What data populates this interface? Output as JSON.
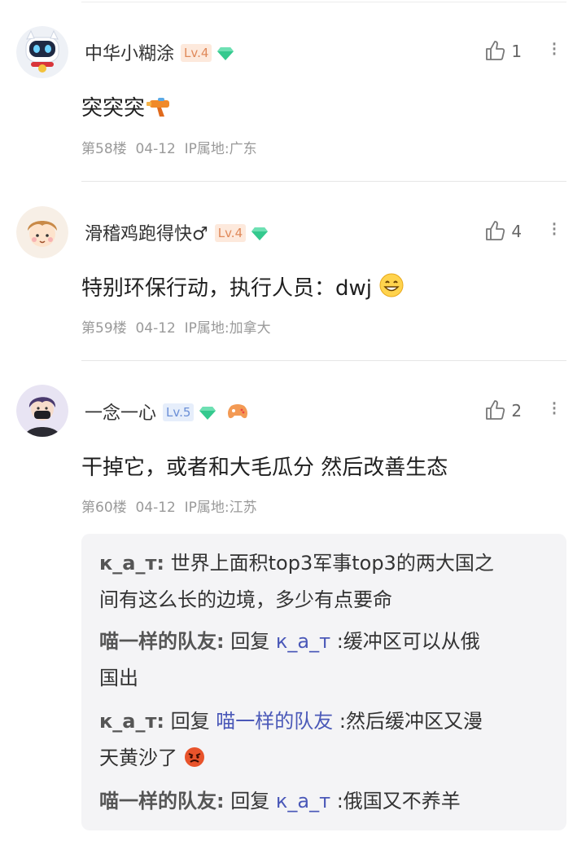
{
  "comments": [
    {
      "username": "中华小糊涂",
      "level": "Lv.4",
      "likes": "1",
      "text": "突突突",
      "emoji": "water-gun",
      "floor": "第58楼",
      "date": "04-12",
      "ip": "IP属地:广东"
    },
    {
      "username": "滑稽鸡跑得快♂",
      "level": "Lv.4",
      "likes": "4",
      "text": "特别环保行动，执行人员：dwj",
      "emoji": "grin-face",
      "floor": "第59楼",
      "date": "04-12",
      "ip": "IP属地:加拿大"
    },
    {
      "username": "一念一心",
      "level": "Lv.5",
      "likes": "2",
      "text": "干掉它，或者和大毛瓜分 然后改善生态",
      "floor": "第60楼",
      "date": "04-12",
      "ip": "IP属地:江苏"
    }
  ],
  "replies": [
    {
      "author": "к_а_т:",
      "text_line1": " 世界上面积top3军事top3的两大国之",
      "text_line2": "间有这么长的边境，多少有点要命"
    },
    {
      "author": "喵一样的队友:",
      "reply_word": " 回复 ",
      "target": "к_а_т",
      "text_line1": " :缓冲区可以从俄",
      "text_line2": "国出"
    },
    {
      "author": "к_а_т:",
      "reply_word": " 回复 ",
      "target": "喵一样的队友",
      "text_line1": " :然后缓冲区又漫",
      "text_line2": "天黄沙了"
    },
    {
      "author": "喵一样的队友:",
      "reply_word": " 回复 ",
      "target": "к_а_т",
      "text_line1": " :俄国又不养羊"
    }
  ],
  "colors": {
    "level4": "#e0895a",
    "level5": "#6b8fd6",
    "gem": "#34c98e",
    "link": "#4a58b8"
  }
}
